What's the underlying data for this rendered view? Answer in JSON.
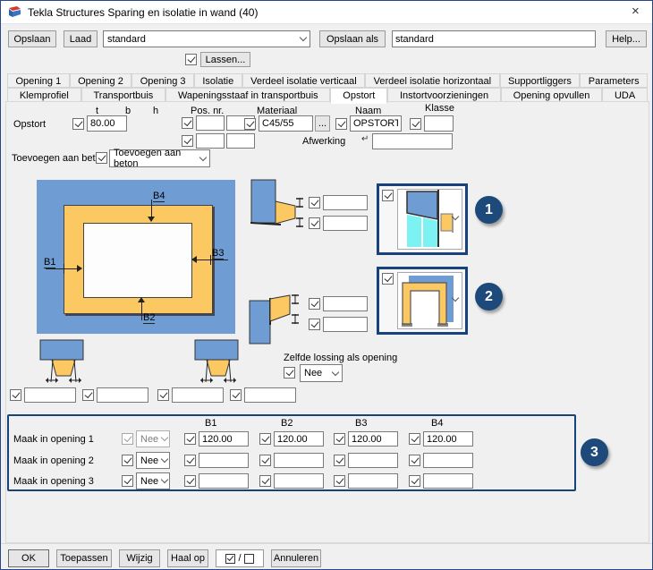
{
  "titlebar": {
    "title": "Tekla Structures  Sparing en isolatie in wand (40)",
    "close": "×"
  },
  "toolbar": {
    "opslaan": "Opslaan",
    "laad": "Laad",
    "preset_value": "standard",
    "opslaan_als": "Opslaan als",
    "opslaan_als_value": "standard",
    "help": "Help...",
    "lassen": "Lassen..."
  },
  "tabs": {
    "row1": [
      "Opening 1",
      "Opening 2",
      "Opening 3",
      "Isolatie",
      "Verdeel isolatie verticaal",
      "Verdeel isolatie horizontaal",
      "Supportliggers",
      "Parameters"
    ],
    "row2": [
      "Klemprofiel",
      "Transportbuis",
      "Wapeningsstaaf in transportbuis",
      "Opstort",
      "Instortvoorzieningen",
      "Opening opvullen",
      "UDA"
    ],
    "active": "Opstort"
  },
  "form": {
    "col_t": "t",
    "col_b": "b",
    "col_h": "h",
    "opstort_label": "Opstort",
    "opstort_t_value": "80.00",
    "pos_nr_label": "Pos. nr.",
    "materiaal_label": "Materiaal",
    "materiaal_value": "C45/55",
    "browse": "...",
    "naam_label": "Naam",
    "naam_value": "OPSTORT",
    "klasse_label": "Klasse",
    "klasse_value": "",
    "afwerking_label": "Afwerking",
    "afwerking_value": "",
    "afwerking_icon": "↵",
    "toevoegen_label": "Toevoegen aan beton",
    "toevoegen_value": "Toevoegen aan beton"
  },
  "diagram": {
    "b1": "B1",
    "b2": "B2",
    "b3": "B3",
    "b4": "B4"
  },
  "side_fields": {
    "top1": "",
    "top2": "",
    "bottom1": "",
    "bottom2": ""
  },
  "lossing": {
    "label": "Zelfde lossing als opening",
    "value": "Nee"
  },
  "bottom_fields": {
    "g1f1": "",
    "g1f2": "",
    "g2f1": "",
    "g2f2": ""
  },
  "callouts": {
    "one": "1",
    "two": "2",
    "three": "3"
  },
  "table": {
    "headers": [
      "B1",
      "B2",
      "B3",
      "B4"
    ],
    "rows": [
      {
        "label": "Maak in opening 1",
        "combo": "Nee",
        "values": [
          "120.00",
          "120.00",
          "120.00",
          "120.00"
        ]
      },
      {
        "label": "Maak in opening 2",
        "combo": "Nee",
        "values": [
          "",
          "",
          "",
          ""
        ]
      },
      {
        "label": "Maak in opening 3",
        "combo": "Nee",
        "values": [
          "",
          "",
          "",
          ""
        ]
      }
    ]
  },
  "footer": {
    "ok": "OK",
    "toepassen": "Toepassen",
    "wijzig": "Wijzig",
    "haal_op": "Haal op",
    "toggle_separator": "/",
    "annuleren": "Annuleren"
  },
  "colors": {
    "diagram_blue": "#6f9cd3",
    "diagram_yellow": "#fbc862",
    "diagram_cyan": "#7df2f2",
    "badge_navy": "#1d4a7a",
    "frame_navy": "#17427c"
  }
}
